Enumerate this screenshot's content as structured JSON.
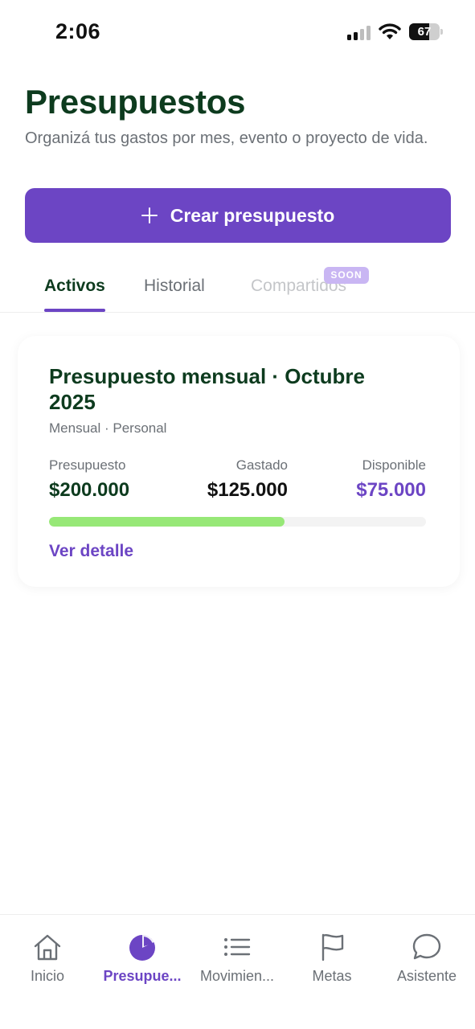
{
  "status_bar": {
    "time": "2:06",
    "battery": "67",
    "battery_level": 0.67
  },
  "header": {
    "title": "Presupuestos",
    "subtitle": "Organizá tus gastos por mes, evento o proyecto de vida."
  },
  "create_button": {
    "label": "Crear presupuesto",
    "icon": "plus-icon"
  },
  "tabs": [
    {
      "label": "Activos",
      "active": true
    },
    {
      "label": "Historial",
      "active": false
    },
    {
      "label": "Compartidos",
      "active": false,
      "disabled": true,
      "badge": "SOON"
    }
  ],
  "budget_card": {
    "title": "Presupuesto mensual · Octubre 2025",
    "meta": "Mensual · Personal",
    "budget_label": "Presupuesto",
    "budget_value": "$200.000",
    "spent_label": "Gastado",
    "spent_value": "$125.000",
    "available_label": "Disponible",
    "available_value": "$75.000",
    "progress": 0.625,
    "detail_link": "Ver detalle"
  },
  "bottom_nav": [
    {
      "label": "Inicio",
      "icon": "home-icon",
      "active": false
    },
    {
      "label": "Presupue...",
      "icon": "pie-chart-icon",
      "active": true
    },
    {
      "label": "Movimien...",
      "icon": "list-icon",
      "active": false
    },
    {
      "label": "Metas",
      "icon": "flag-icon",
      "active": false
    },
    {
      "label": "Asistente",
      "icon": "chat-bubble-icon",
      "active": false
    }
  ],
  "colors": {
    "accent": "#6c45c4",
    "title": "#0d3b1e",
    "progress": "#97e877",
    "badge": "#c9b6f3"
  }
}
